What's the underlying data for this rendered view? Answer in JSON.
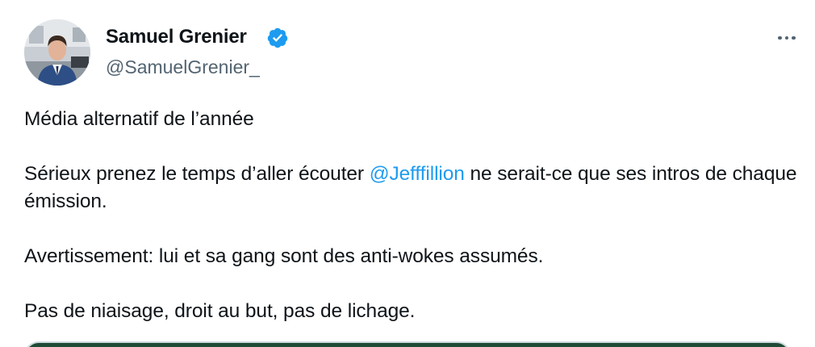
{
  "author": {
    "name": "Samuel Grenier",
    "handle": "@SamuelGrenier_",
    "verified": true,
    "avatar_icon": "profile-photo"
  },
  "more_icon": "more-horizontal-icon",
  "tweet": {
    "line1": "Média alternatif de l’année",
    "line2_before": "Sérieux prenez le temps d’aller écouter ",
    "mention": "@Jefffillion",
    "line2_after": " ne serait-ce que ses intros de chaque émission.",
    "line3": "Avertissement: lui et sa gang sont des anti-wokes assumés.",
    "line4": "Pas de niaisage, droit au but, pas de lichage."
  },
  "colors": {
    "name": "#0f1419",
    "handle": "#536471",
    "mention": "#1d9bf0",
    "verified_badge": "#1d9bf0",
    "media_edge": "#1e4a36"
  }
}
